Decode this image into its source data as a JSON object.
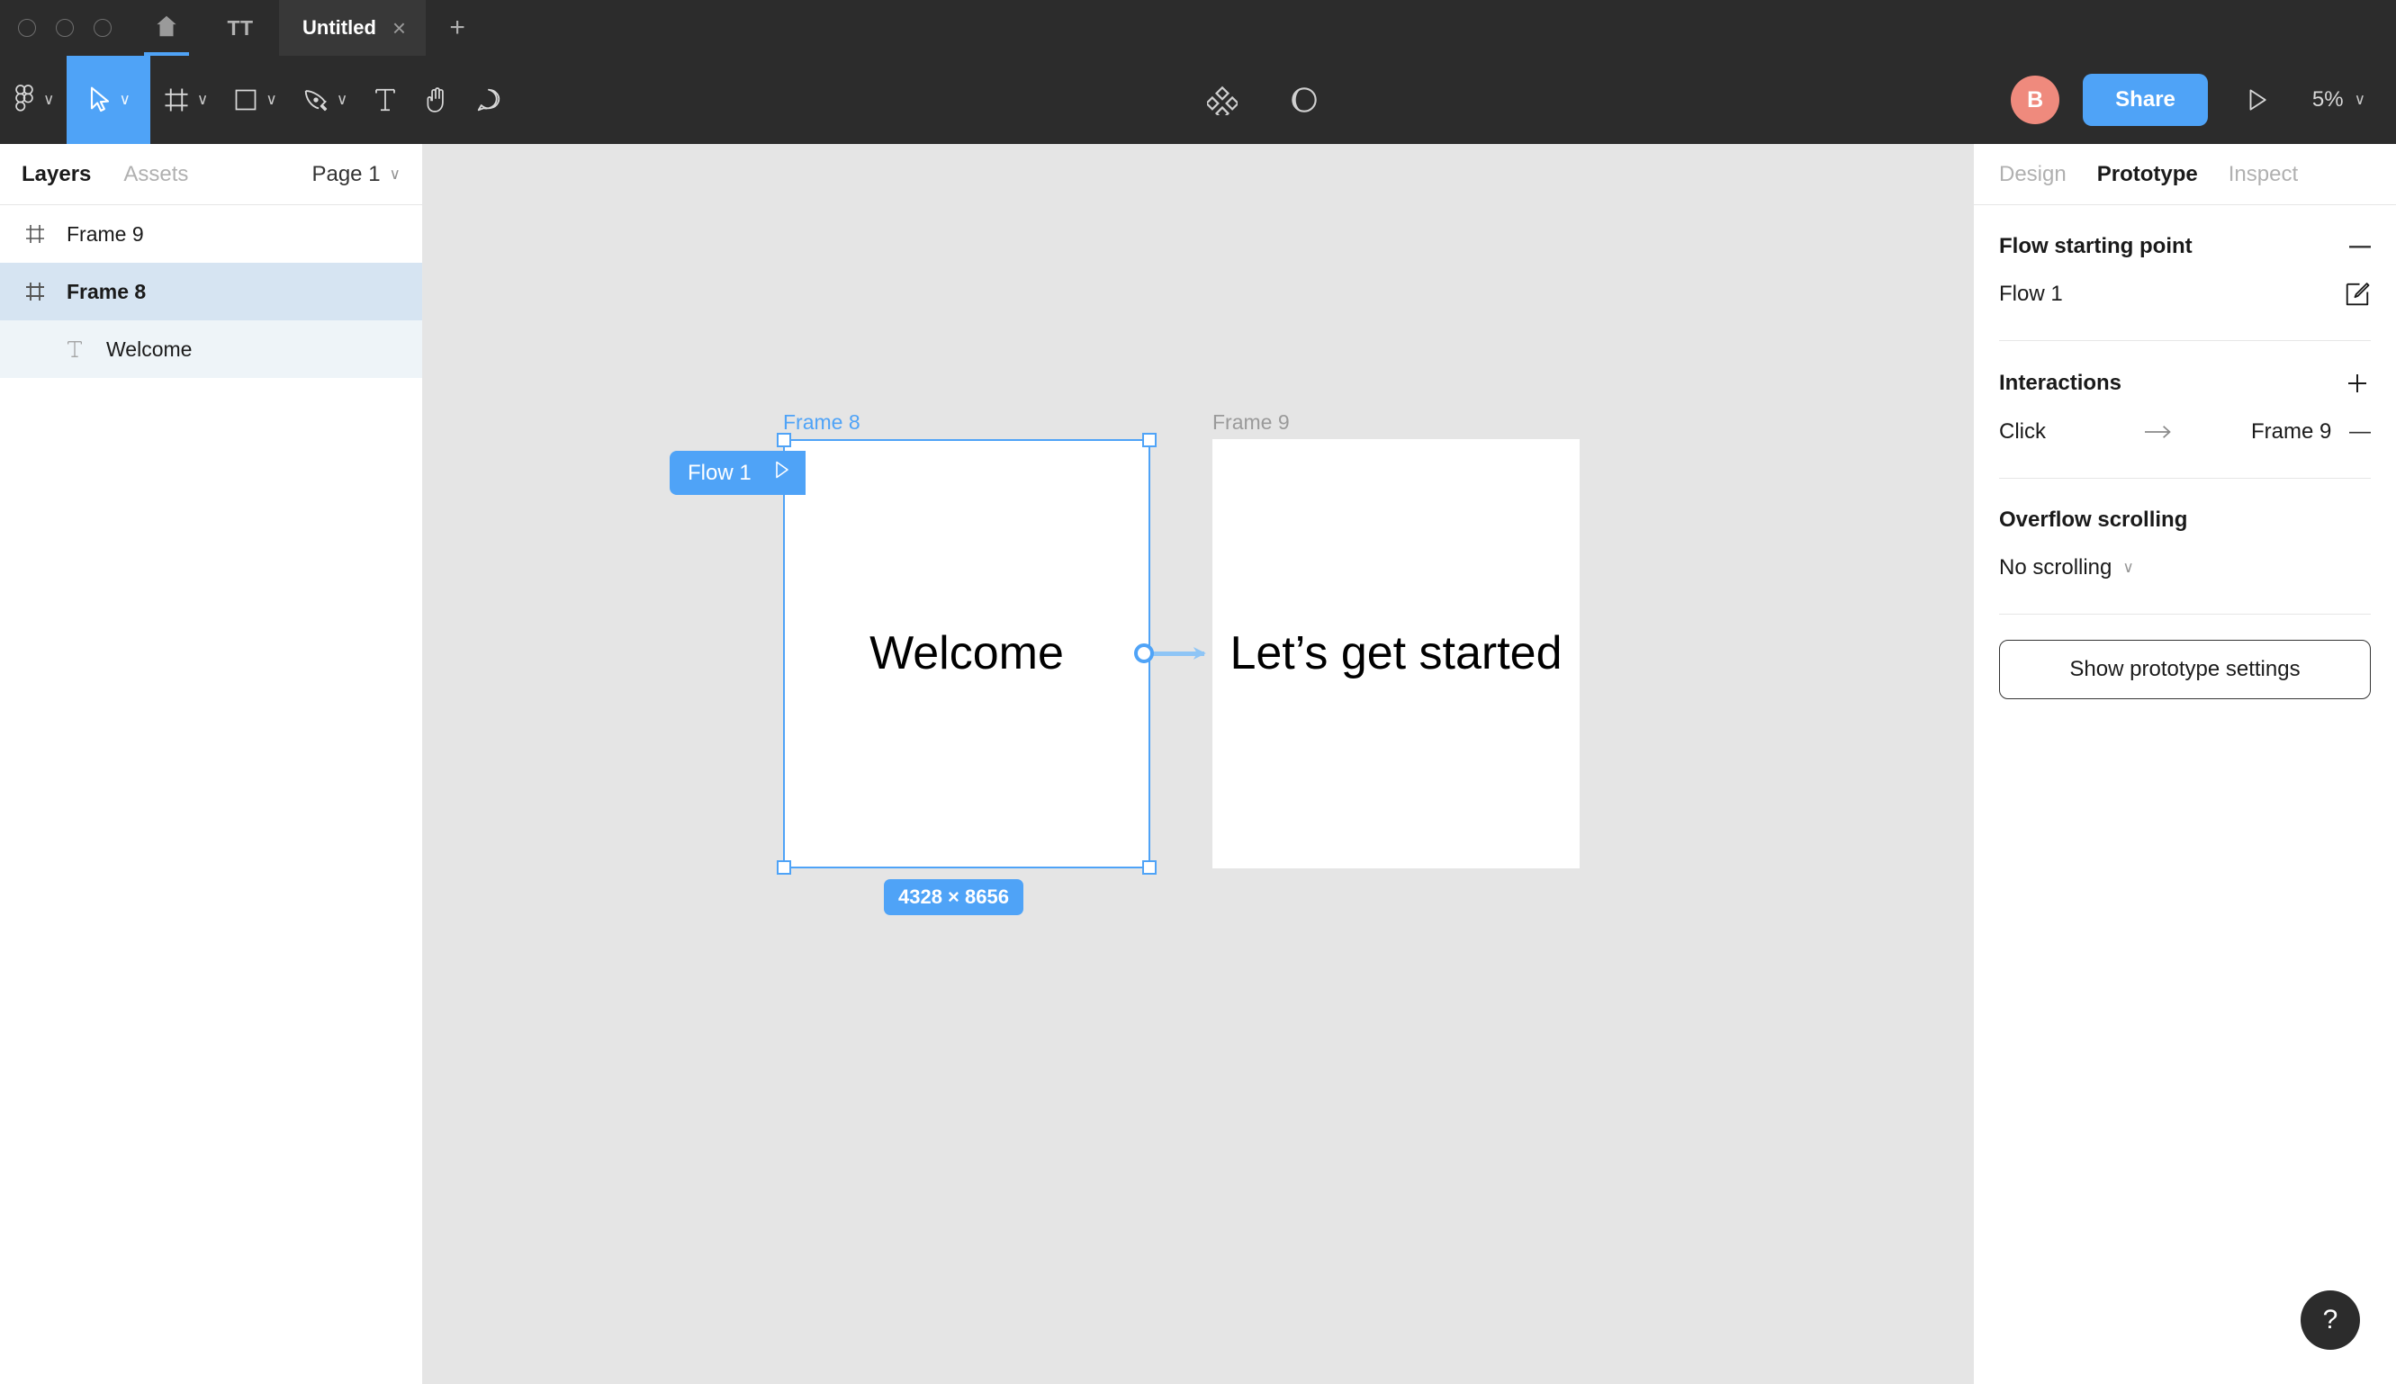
{
  "tabbar": {
    "window_buttons": [
      "close",
      "minimize",
      "maximize"
    ],
    "home_icon": "home-icon",
    "tt_label": "TT",
    "doc_tab_title": "Untitled",
    "doc_tab_close": "×",
    "new_tab": "+"
  },
  "toolbar": {
    "tools": [
      {
        "name": "figma-menu-icon",
        "chevron": "∨"
      },
      {
        "name": "move-tool-icon",
        "chevron": "∨"
      },
      {
        "name": "frame-tool-icon",
        "chevron": "∨"
      },
      {
        "name": "shape-tool-icon",
        "chevron": "∨"
      },
      {
        "name": "pen-tool-icon",
        "chevron": "∨"
      },
      {
        "name": "text-tool-icon",
        "chevron": ""
      },
      {
        "name": "hand-tool-icon",
        "chevron": ""
      },
      {
        "name": "comment-tool-icon",
        "chevron": ""
      }
    ],
    "components_icon": "components-icon",
    "mask_icon": "mask-icon",
    "avatar_initial": "B",
    "share_label": "Share",
    "present_icon": "present-play-icon",
    "zoom_level": "5%",
    "zoom_chevron": "∨"
  },
  "left_panel": {
    "tab_layers": "Layers",
    "tab_assets": "Assets",
    "page_name": "Page 1",
    "page_chevron": "∨",
    "layers": [
      {
        "name": "Frame 9",
        "icon": "frame-icon",
        "selected": false,
        "child": false
      },
      {
        "name": "Frame 8",
        "icon": "frame-icon",
        "selected": true,
        "child": false
      },
      {
        "name": "Welcome",
        "icon": "text-layer-icon",
        "selected": false,
        "child": true
      }
    ]
  },
  "canvas": {
    "background_color": "#e5e5e5",
    "frames": [
      {
        "label": "Frame 8",
        "content": "Welcome",
        "selected": true,
        "dimensions_badge": "4328 × 8656"
      },
      {
        "label": "Frame 9",
        "content": "Let’s get started",
        "selected": false,
        "dimensions_badge": ""
      }
    ],
    "flow_badge": {
      "label": "Flow 1",
      "play_icon": "play-outline-icon"
    },
    "connector": {
      "from": "Frame 8",
      "to": "Frame 9",
      "dot_icon": "connector-dot-icon",
      "arrow_icon": "connector-arrow-icon"
    }
  },
  "right_panel": {
    "tabs": [
      {
        "label": "Design",
        "active": false
      },
      {
        "label": "Prototype",
        "active": true
      },
      {
        "label": "Inspect",
        "active": false
      }
    ],
    "flow_section": {
      "title": "Flow starting point",
      "collapse_icon": "—",
      "flow_name": "Flow 1",
      "edit_icon": "edit-pencil-icon"
    },
    "interactions_section": {
      "title": "Interactions",
      "add_icon": "+",
      "trigger": "Click",
      "arrow": "→",
      "destination": "Frame 9",
      "remove_icon": "—"
    },
    "overflow_section": {
      "title": "Overflow scrolling",
      "value": "No scrolling",
      "chevron": "∨"
    },
    "prototype_settings_button": "Show prototype settings"
  },
  "help_button": {
    "label": "?"
  },
  "colors": {
    "accent_blue": "#4fa3f7",
    "toolbar_dark": "#2c2c2c",
    "tab_active_dark": "#383838",
    "canvas_gray": "#e5e5e5",
    "layer_selected": "#d6e4f2",
    "layer_child": "#eef4f8",
    "avatar_coral": "#ef8a7d"
  }
}
